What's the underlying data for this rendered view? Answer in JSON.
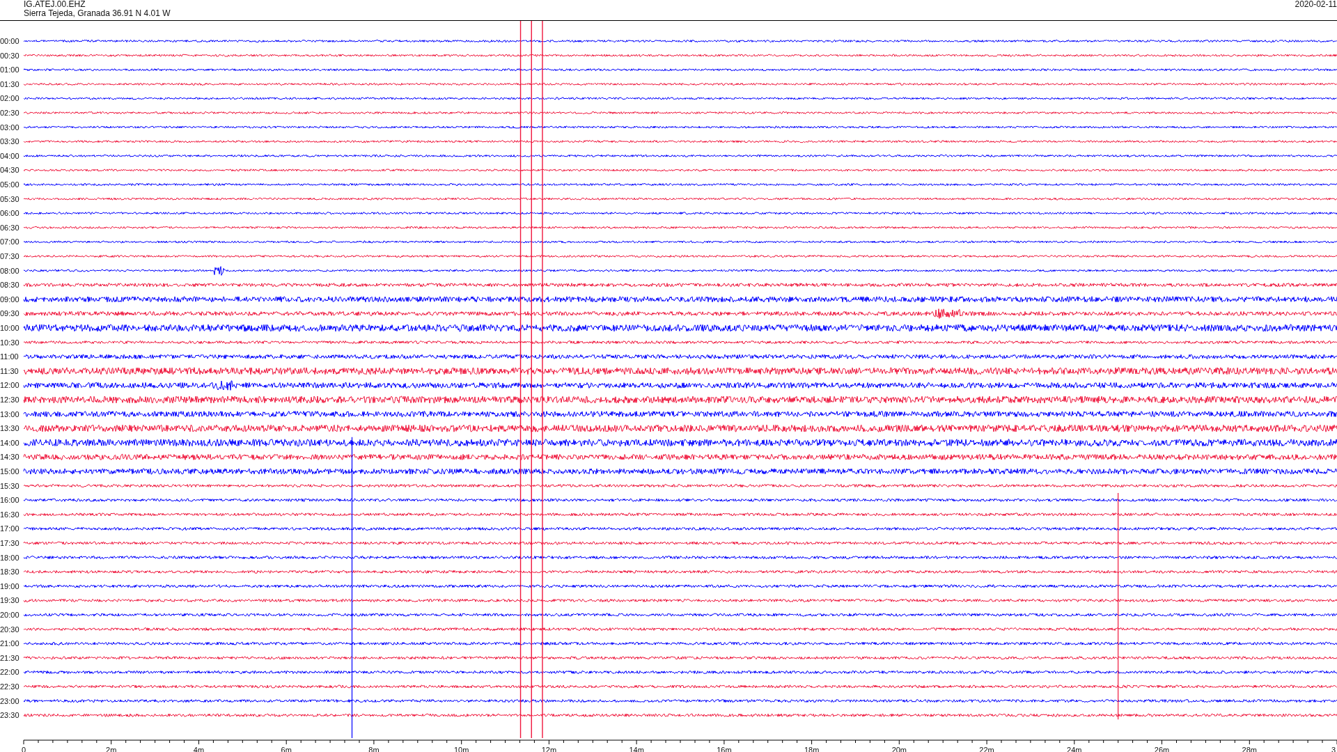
{
  "header": {
    "station": "IG.ATEJ.00.EHZ",
    "location": "Sierra Tejeda, Granada  36.91 N 4.01 W",
    "date": "2020-02-11"
  },
  "rows": [
    {
      "label": "00:00",
      "color": "#0000ff"
    },
    {
      "label": "00:30",
      "color": "#f0163c"
    },
    {
      "label": "01:00",
      "color": "#0000ff"
    },
    {
      "label": "01:30",
      "color": "#f0163c"
    },
    {
      "label": "02:00",
      "color": "#0000ff"
    },
    {
      "label": "02:30",
      "color": "#f0163c"
    },
    {
      "label": "03:00",
      "color": "#0000ff"
    },
    {
      "label": "03:30",
      "color": "#f0163c"
    },
    {
      "label": "04:00",
      "color": "#0000ff"
    },
    {
      "label": "04:30",
      "color": "#f0163c"
    },
    {
      "label": "05:00",
      "color": "#0000ff"
    },
    {
      "label": "05:30",
      "color": "#f0163c"
    },
    {
      "label": "06:00",
      "color": "#0000ff"
    },
    {
      "label": "06:30",
      "color": "#f0163c"
    },
    {
      "label": "07:00",
      "color": "#0000ff"
    },
    {
      "label": "07:30",
      "color": "#f0163c"
    },
    {
      "label": "08:00",
      "color": "#0000ff"
    },
    {
      "label": "08:30",
      "color": "#f0163c"
    },
    {
      "label": "09:00",
      "color": "#0000ff"
    },
    {
      "label": "09:30",
      "color": "#f0163c"
    },
    {
      "label": "10:00",
      "color": "#0000ff"
    },
    {
      "label": "10:30",
      "color": "#f0163c"
    },
    {
      "label": "11:00",
      "color": "#0000ff"
    },
    {
      "label": "11:30",
      "color": "#f0163c"
    },
    {
      "label": "12:00",
      "color": "#0000ff"
    },
    {
      "label": "12:30",
      "color": "#f0163c"
    },
    {
      "label": "13:00",
      "color": "#0000ff"
    },
    {
      "label": "13:30",
      "color": "#f0163c"
    },
    {
      "label": "14:00",
      "color": "#0000ff"
    },
    {
      "label": "14:30",
      "color": "#f0163c"
    },
    {
      "label": "15:00",
      "color": "#0000ff"
    },
    {
      "label": "15:30",
      "color": "#f0163c"
    },
    {
      "label": "16:00",
      "color": "#0000ff"
    },
    {
      "label": "16:30",
      "color": "#f0163c"
    },
    {
      "label": "17:00",
      "color": "#0000ff"
    },
    {
      "label": "17:30",
      "color": "#f0163c"
    },
    {
      "label": "18:00",
      "color": "#0000ff"
    },
    {
      "label": "18:30",
      "color": "#f0163c"
    },
    {
      "label": "19:00",
      "color": "#0000ff"
    },
    {
      "label": "19:30",
      "color": "#f0163c"
    },
    {
      "label": "20:00",
      "color": "#0000ff"
    },
    {
      "label": "20:30",
      "color": "#f0163c"
    },
    {
      "label": "21:00",
      "color": "#0000ff"
    },
    {
      "label": "21:30",
      "color": "#f0163c"
    },
    {
      "label": "22:00",
      "color": "#0000ff"
    },
    {
      "label": "22:30",
      "color": "#f0163c"
    },
    {
      "label": "23:00",
      "color": "#0000ff"
    },
    {
      "label": "23:30",
      "color": "#f0163c"
    }
  ],
  "x_axis": {
    "labels": [
      "0",
      "2m",
      "4m",
      "6m",
      "8m",
      "10m",
      "12m",
      "14m",
      "16m",
      "18m",
      "20m",
      "22m",
      "24m",
      "26m",
      "28m",
      "3"
    ]
  }
}
